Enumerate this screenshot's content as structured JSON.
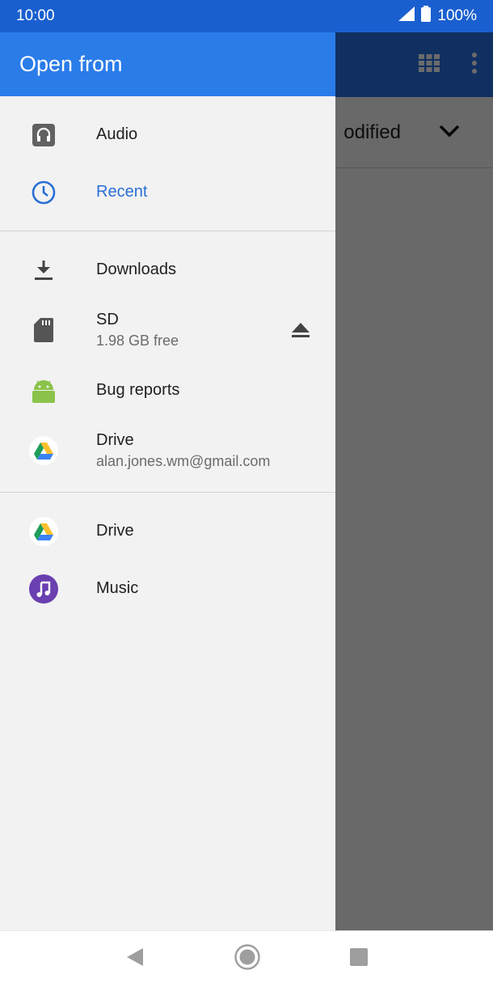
{
  "status": {
    "time": "10:00",
    "battery": "100%"
  },
  "drawer": {
    "title": "Open from",
    "sections": [
      {
        "items": [
          {
            "label": "Audio",
            "icon": "headphones-icon"
          },
          {
            "label": "Recent",
            "icon": "clock-icon",
            "active": true
          }
        ]
      },
      {
        "items": [
          {
            "label": "Downloads",
            "icon": "download-icon"
          },
          {
            "label": "SD",
            "sub": "1.98 GB free",
            "icon": "sd-card-icon",
            "trail": "eject-icon"
          },
          {
            "label": "Bug reports",
            "icon": "android-icon"
          },
          {
            "label": "Drive",
            "sub": "alan.jones.wm@gmail.com",
            "icon": "drive-icon"
          }
        ]
      },
      {
        "items": [
          {
            "label": "Drive",
            "icon": "drive-icon"
          },
          {
            "label": "Music",
            "icon": "music-icon"
          }
        ]
      }
    ]
  },
  "underlay": {
    "sort_label": "odified"
  },
  "colors": {
    "accent": "#2a7ce9",
    "status_bar": "#1a5fd0",
    "active_text": "#2a6fd6"
  }
}
